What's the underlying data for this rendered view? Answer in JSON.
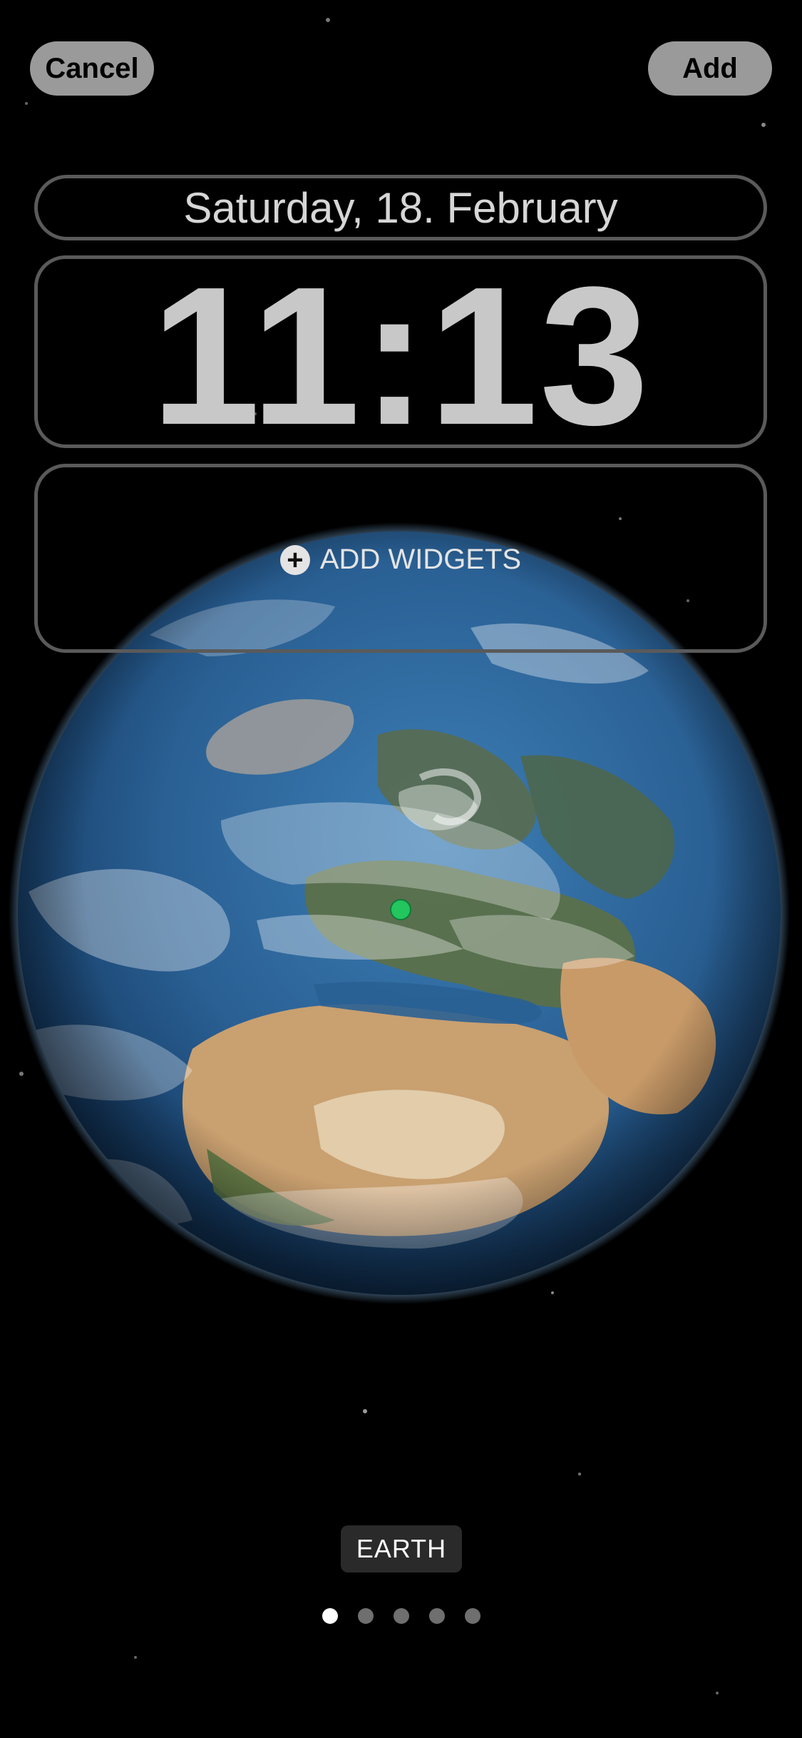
{
  "header": {
    "cancel_label": "Cancel",
    "add_label": "Add"
  },
  "lockscreen": {
    "date": "Saturday, 18. February",
    "time": "11:13",
    "add_widgets_label": "ADD WIDGETS"
  },
  "wallpaper": {
    "name": "EARTH",
    "page_count": 5,
    "active_page": 1
  },
  "colors": {
    "background": "#000000",
    "button_bg": "#9a9a9a",
    "frame_border": "#5a5a5a",
    "location_dot": "#22c55e",
    "ocean": "#2f6ea3"
  },
  "icons": {
    "add_widgets": "plus-circle-icon",
    "location": "location-dot-icon"
  }
}
